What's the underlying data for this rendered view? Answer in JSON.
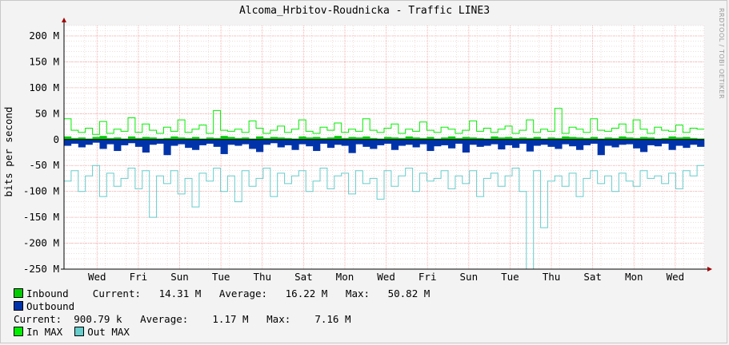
{
  "chart_data": {
    "type": "area",
    "title": "Alcoma_Hrbitov-Roudnicka - Traffic LINE3",
    "watermark": "RRDTOOL / TOBI OETIKER",
    "ylabel": "bits per second",
    "ylim": [
      -250,
      220
    ],
    "yticks": [
      {
        "value": 200,
        "label": "200 M"
      },
      {
        "value": 150,
        "label": "150 M"
      },
      {
        "value": 100,
        "label": "100 M"
      },
      {
        "value": 50,
        "label": "50 M"
      },
      {
        "value": 0,
        "label": "0"
      },
      {
        "value": -50,
        "label": "-50 M"
      },
      {
        "value": -100,
        "label": "-100 M"
      },
      {
        "value": -150,
        "label": "-150 M"
      },
      {
        "value": -200,
        "label": "-200 M"
      },
      {
        "value": -250,
        "label": "-250 M"
      }
    ],
    "xticks": [
      "Wed",
      "Fri",
      "Sun",
      "Tue",
      "Thu",
      "Sat",
      "Mon",
      "Wed",
      "Fri",
      "Sun",
      "Tue",
      "Thu",
      "Sat",
      "Mon",
      "Wed"
    ],
    "grid": true,
    "colors": {
      "inbound": "#00cc00",
      "outbound": "#0033aa",
      "in_max": "#00ee00",
      "out_max": "#66cccc",
      "grid_major": "#f5a0a0",
      "grid_minor": "#e8c8c8"
    },
    "series": [
      {
        "name": "Inbound",
        "values": [
          6,
          3,
          4,
          2,
          5,
          7,
          3,
          4,
          2,
          6,
          3,
          5,
          4,
          2,
          3,
          6,
          4,
          3,
          5,
          2,
          4,
          3,
          7,
          5,
          3,
          4,
          2,
          6,
          3,
          5,
          4,
          3,
          2,
          6,
          4,
          5,
          3,
          4,
          7,
          3,
          5,
          4,
          6,
          3,
          2,
          5,
          4,
          3,
          6,
          4,
          3,
          5,
          2,
          4,
          6,
          3,
          5,
          4,
          3,
          2,
          6,
          4,
          5,
          3,
          4,
          3,
          5,
          2,
          4,
          3,
          6,
          5,
          4,
          3,
          5,
          2,
          4,
          3,
          6,
          4,
          3,
          5,
          4,
          2,
          3,
          6,
          4,
          5,
          3,
          2
        ]
      },
      {
        "name": "Outbound",
        "values": [
          -12,
          -8,
          -15,
          -10,
          -6,
          -18,
          -9,
          -22,
          -11,
          -7,
          -14,
          -25,
          -10,
          -8,
          -30,
          -12,
          -9,
          -16,
          -20,
          -11,
          -8,
          -14,
          -28,
          -10,
          -12,
          -9,
          -18,
          -24,
          -10,
          -7,
          -15,
          -11,
          -20,
          -9,
          -13,
          -22,
          -8,
          -16,
          -10,
          -12,
          -26,
          -9,
          -14,
          -18,
          -11,
          -8,
          -20,
          -12,
          -10,
          -15,
          -9,
          -22,
          -13,
          -11,
          -17,
          -8,
          -25,
          -10,
          -14,
          -12,
          -9,
          -19,
          -11,
          -16,
          -8,
          -23,
          -12,
          -10,
          -14,
          -18,
          -9,
          -13,
          -20,
          -11,
          -8,
          -30,
          -12,
          -15,
          -10,
          -9,
          -17,
          -24,
          -11,
          -13,
          -8,
          -20,
          -12,
          -16,
          -10,
          -14
        ]
      },
      {
        "name": "In MAX",
        "values": [
          40,
          18,
          14,
          22,
          10,
          35,
          12,
          20,
          16,
          42,
          14,
          30,
          18,
          12,
          24,
          16,
          38,
          14,
          20,
          28,
          12,
          56,
          18,
          16,
          20,
          14,
          36,
          22,
          12,
          18,
          26,
          14,
          20,
          38,
          16,
          12,
          24,
          18,
          32,
          14,
          20,
          16,
          40,
          18,
          14,
          22,
          30,
          12,
          20,
          16,
          34,
          18,
          14,
          24,
          20,
          12,
          18,
          36,
          16,
          22,
          14,
          20,
          26,
          12,
          18,
          38,
          14,
          20,
          16,
          60,
          12,
          24,
          20,
          14,
          40,
          18,
          16,
          22,
          30,
          14,
          38,
          20,
          12,
          24,
          18,
          16,
          28,
          14,
          22,
          20
        ]
      },
      {
        "name": "Out MAX",
        "values": [
          -80,
          -60,
          -100,
          -70,
          -50,
          -110,
          -65,
          -90,
          -75,
          -55,
          -95,
          -60,
          -150,
          -70,
          -85,
          -60,
          -105,
          -75,
          -130,
          -65,
          -80,
          -55,
          -100,
          -70,
          -120,
          -60,
          -90,
          -75,
          -55,
          -110,
          -65,
          -85,
          -70,
          -60,
          -100,
          -80,
          -55,
          -95,
          -70,
          -65,
          -105,
          -60,
          -85,
          -75,
          -115,
          -60,
          -90,
          -70,
          -55,
          -100,
          -65,
          -80,
          -75,
          -60,
          -95,
          -70,
          -85,
          -60,
          -110,
          -75,
          -65,
          -90,
          -70,
          -55,
          -100,
          -250,
          -60,
          -170,
          -80,
          -70,
          -90,
          -65,
          -110,
          -75,
          -60,
          -85,
          -70,
          -100,
          -65,
          -80,
          -90,
          -60,
          -75,
          -70,
          -85,
          -65,
          -95,
          -60,
          -70,
          -50
        ]
      }
    ]
  },
  "legend": {
    "inbound_label": "Inbound",
    "inbound_current_label": "Current:",
    "inbound_current": "14.31 M",
    "inbound_average_label": "Average:",
    "inbound_average": "16.22 M",
    "inbound_max_label": "Max:",
    "inbound_max": "50.82 M",
    "outbound_label": "Outbound",
    "outbound_current_label": "Current:",
    "outbound_current": "900.79 k",
    "outbound_average_label": "Average:",
    "outbound_average": "1.17 M",
    "outbound_max_label": "Max:",
    "outbound_max": "7.16 M",
    "in_max_label": "In MAX",
    "out_max_label": "Out MAX"
  }
}
